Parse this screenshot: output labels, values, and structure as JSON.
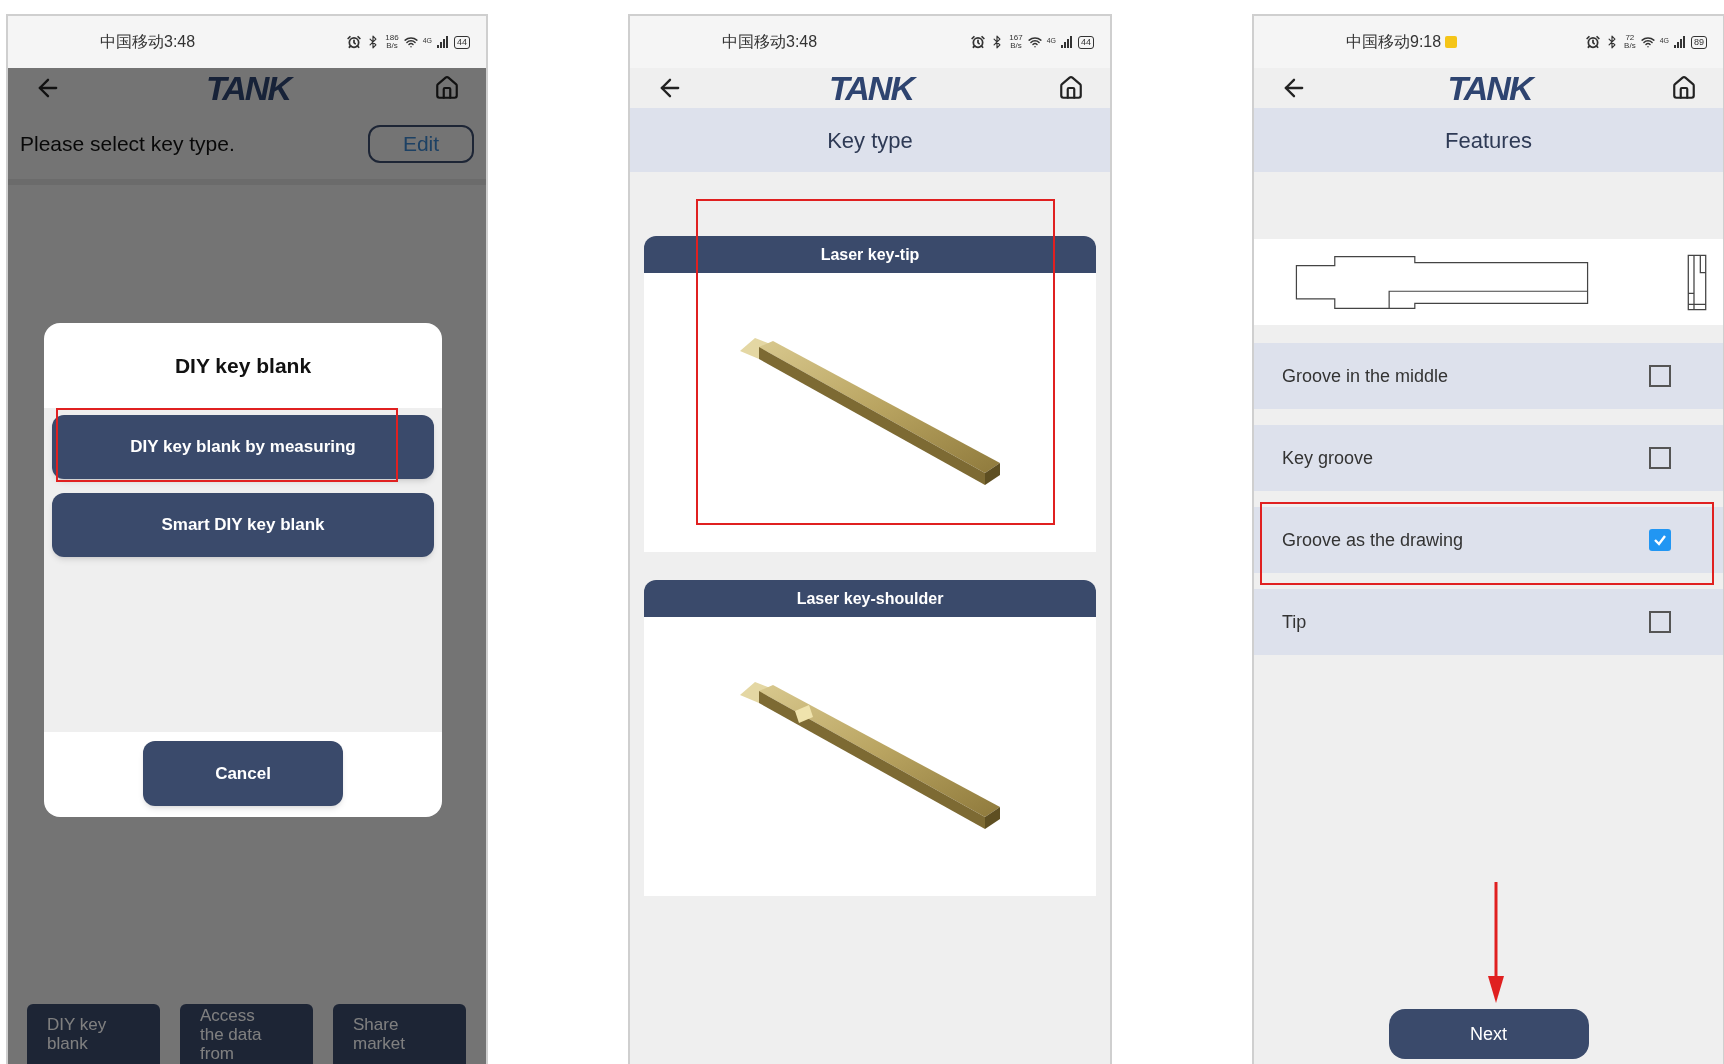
{
  "screens": [
    {
      "kind": "dialog",
      "status_bar": {
        "carrier_time": "中国移动3:48",
        "speed": "186",
        "speed_unit": "B/s",
        "network": "4G",
        "battery": "44",
        "notification": false
      },
      "header": {
        "logo": "TANK"
      },
      "prompt": "Please select key type.",
      "edit_button": "Edit",
      "bottom_tabs": [
        "DIY key blank",
        "Access the data from",
        "Share market"
      ],
      "dialog": {
        "title": "DIY key blank",
        "options": [
          "DIY key blank by measuring",
          "Smart DIY key blank"
        ],
        "cancel": "Cancel"
      }
    },
    {
      "kind": "cards",
      "status_bar": {
        "carrier_time": "中国移动3:48",
        "speed": "167",
        "speed_unit": "B/s",
        "network": "4G",
        "battery": "44",
        "notification": false
      },
      "header": {
        "logo": "TANK"
      },
      "title": "Key type",
      "cards": [
        {
          "label": "Laser key-tip",
          "kind": "tip"
        },
        {
          "label": "Laser key-shoulder",
          "kind": "shoulder"
        }
      ]
    },
    {
      "kind": "features",
      "status_bar": {
        "carrier_time": "中国移动9:18",
        "speed": "72",
        "speed_unit": "B/s",
        "network": "4G",
        "battery": "89",
        "notification": true
      },
      "header": {
        "logo": "TANK"
      },
      "title": "Features",
      "options": [
        {
          "label": "Groove in the middle",
          "checked": false
        },
        {
          "label": "Key groove",
          "checked": false
        },
        {
          "label": "Groove as the drawing",
          "checked": true
        },
        {
          "label": "Tip",
          "checked": false
        }
      ],
      "next_button": "Next"
    }
  ]
}
